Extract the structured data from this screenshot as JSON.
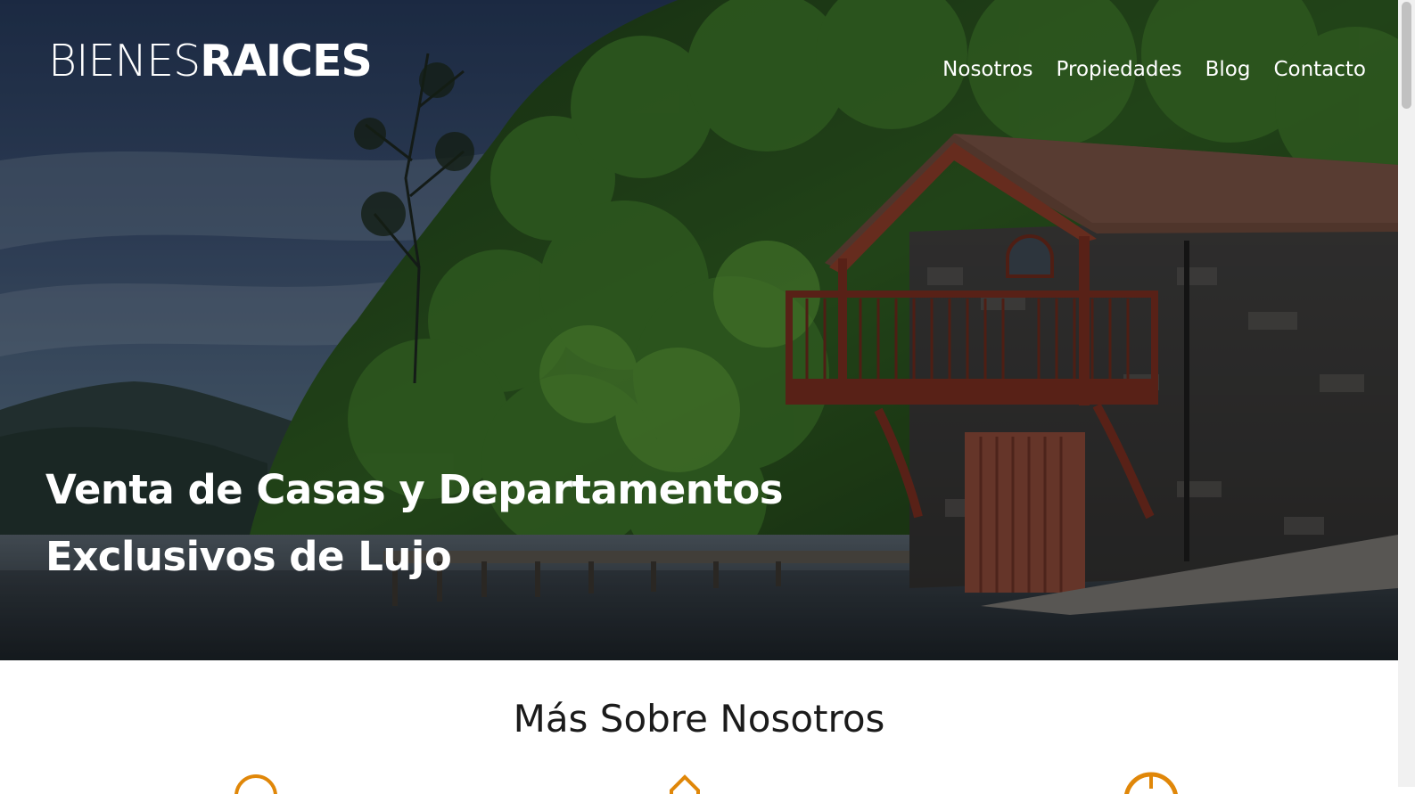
{
  "header": {
    "logo_light": "BIENES",
    "logo_bold": "RAICES",
    "nav": [
      {
        "label": "Nosotros"
      },
      {
        "label": "Propiedades"
      },
      {
        "label": "Blog"
      },
      {
        "label": "Contacto"
      }
    ]
  },
  "hero": {
    "line1": "Venta de Casas y Departamentos",
    "line2": "Exclusivos de Lujo"
  },
  "about": {
    "title": "Más Sobre Nosotros",
    "icon_color": "#e08709",
    "icons": [
      "security-icon",
      "price-tag-icon",
      "clock-icon"
    ]
  }
}
